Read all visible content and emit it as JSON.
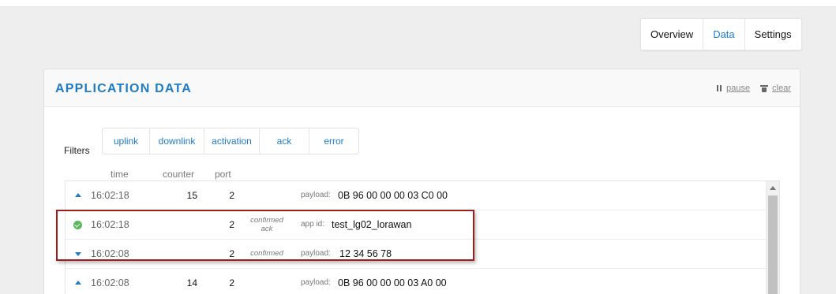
{
  "tabs": [
    {
      "label": "Overview",
      "active": false
    },
    {
      "label": "Data",
      "active": true
    },
    {
      "label": "Settings",
      "active": false
    }
  ],
  "panel": {
    "title": "APPLICATION DATA",
    "pause_label": "pause",
    "clear_label": "clear"
  },
  "filters": {
    "label": "Filters",
    "buttons": [
      "uplink",
      "downlink",
      "activation",
      "ack",
      "error"
    ]
  },
  "columns": {
    "time": "time",
    "counter": "counter",
    "port": "port"
  },
  "rows": [
    {
      "icon": "uplink-arrow-icon",
      "time": "16:02:18",
      "counter": "15",
      "port": "2",
      "flag_line1": "",
      "flag_line2": "",
      "key": "payload:",
      "value": "0B 96 00 00 00 03 C0 00"
    },
    {
      "icon": "check-circle-icon",
      "time": "16:02:18",
      "counter": "",
      "port": "2",
      "flag_line1": "confirmed",
      "flag_line2": "ack",
      "key": "app id:",
      "value": "test_lg02_lorawan"
    },
    {
      "icon": "downlink-arrow-icon",
      "time": "16:02:08",
      "counter": "",
      "port": "2",
      "flag_line1": "confirmed",
      "flag_line2": "",
      "key": "payload:",
      "value": "12 34 56 78"
    },
    {
      "icon": "uplink-arrow-icon",
      "time": "16:02:08",
      "counter": "14",
      "port": "2",
      "flag_line1": "",
      "flag_line2": "",
      "key": "payload:",
      "value": "0B 96 00 00 00 03 A0 00"
    }
  ],
  "colors": {
    "accent": "#1f7cc4",
    "success": "#5cb85c",
    "highlight_border": "#9b1d1d"
  }
}
